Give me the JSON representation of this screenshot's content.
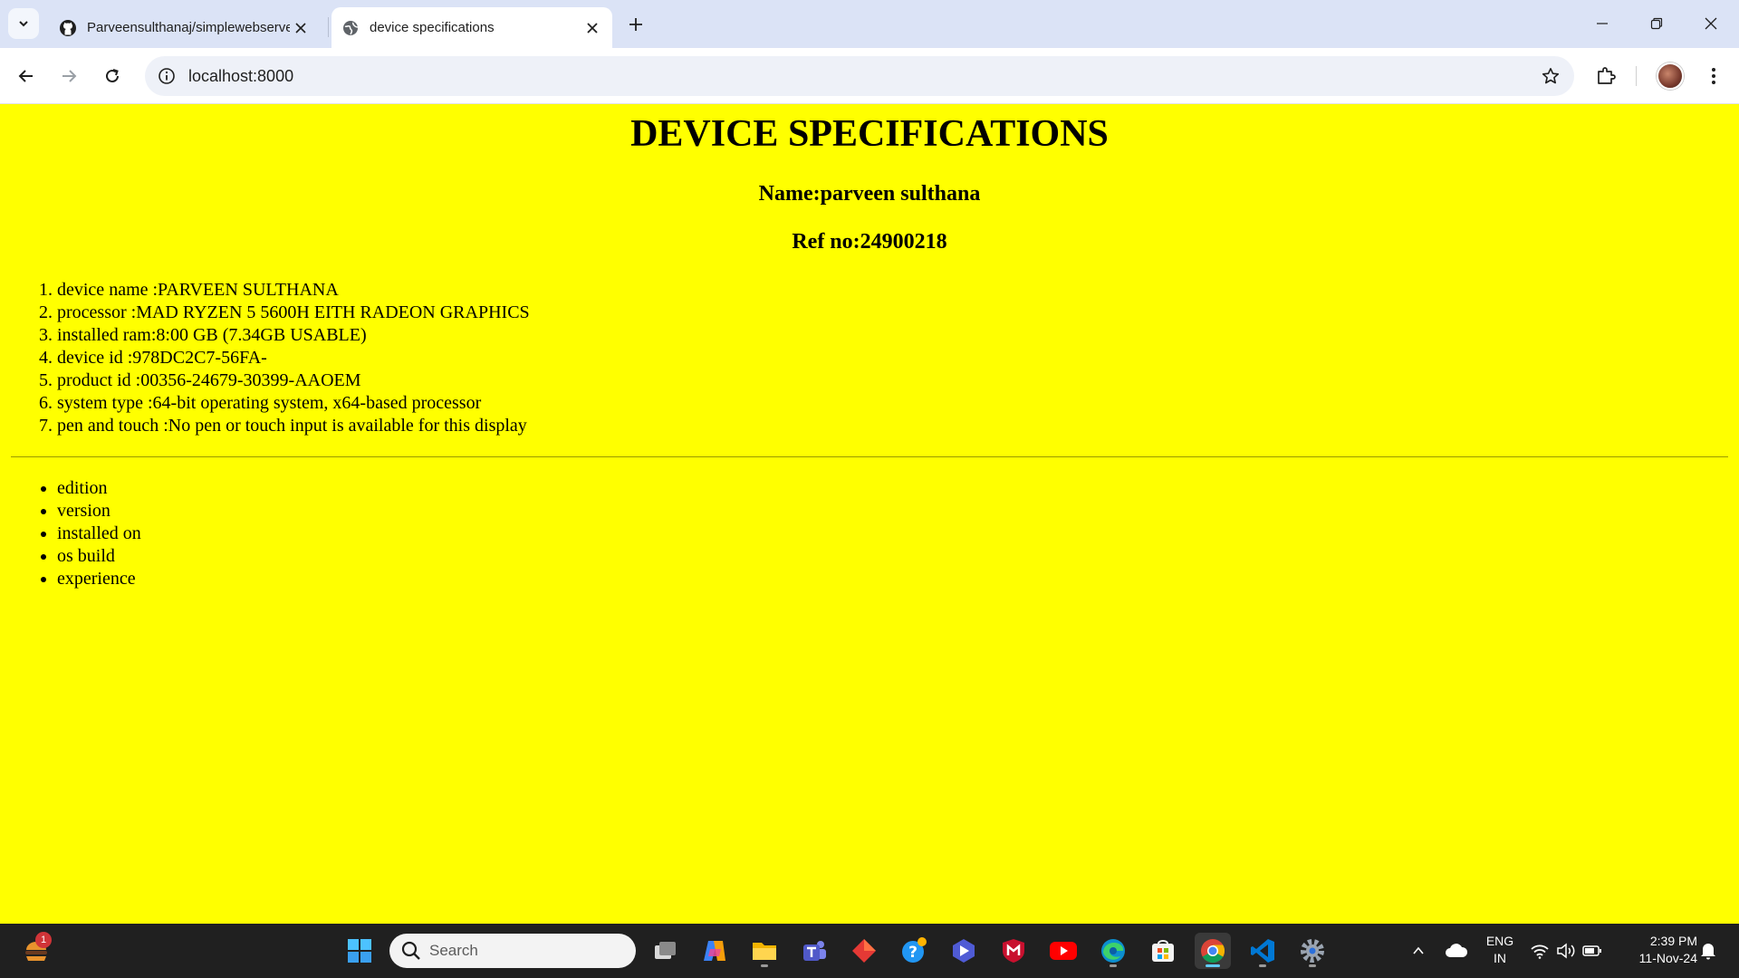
{
  "browser": {
    "tabs": [
      {
        "title": "Parveensulthanaj/simplewebserver",
        "active": false,
        "favicon": "github-icon"
      },
      {
        "title": "device specifications",
        "active": true,
        "favicon": "globe-icon"
      }
    ],
    "url": "localhost:8000"
  },
  "page": {
    "heading": "DEVICE SPECIFICATIONS",
    "name_line": "Name:parveen sulthana",
    "ref_line": "Ref no:24900218",
    "specs": [
      "device name :PARVEEN SULTHANA",
      "processor :MAD RYZEN 5 5600H EITH RADEON GRAPHICS",
      "installed ram:8:00 GB (7.34GB USABLE)",
      "device id :978DC2C7-56FA-",
      "product id :00356-24679-30399-AAOEM",
      "system type :64-bit operating system, x64-based processor",
      "pen and touch :No pen or touch input is available for this display"
    ],
    "windows_items": [
      "edition",
      "version",
      "installed on",
      "os build",
      "experience"
    ]
  },
  "taskbar": {
    "search_placeholder": "Search",
    "notification_badge": "1",
    "language": "ENG",
    "region": "IN",
    "time": "2:39 PM",
    "date": "11-Nov-24"
  },
  "colors": {
    "page_background": "#ffff00",
    "tabstrip": "#dbe3f6",
    "taskbar": "#202020"
  }
}
